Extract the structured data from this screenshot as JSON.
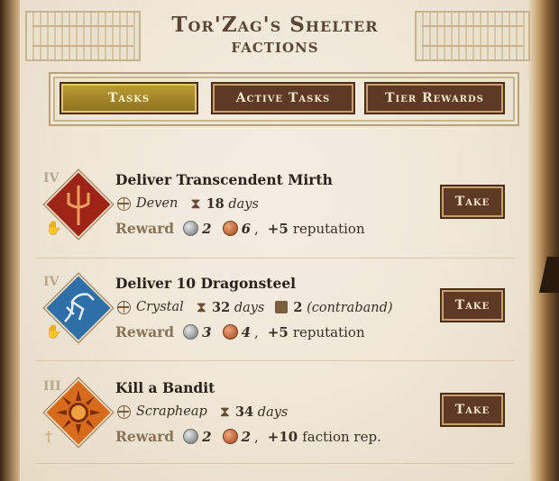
{
  "header": {
    "title": "Tor'Zag's Shelter",
    "subtitle": "FACTIONS"
  },
  "tabs": [
    {
      "label": "Tasks",
      "active": true
    },
    {
      "label": "Active Tasks",
      "active": false
    },
    {
      "label": "Tier Rewards",
      "active": false
    }
  ],
  "tasks": [
    {
      "tier": "IV",
      "title": "Deliver Transcendent Mirth",
      "location": "Deven",
      "days_value": "18",
      "days_unit": "days",
      "extra": "",
      "reward_label": "Reward",
      "silver": "2",
      "copper": "6",
      "rep_value": "+5",
      "rep_text": "reputation",
      "take_label": "Take",
      "icon": "trident-icon",
      "bg_color": "#9e2418"
    },
    {
      "tier": "IV",
      "title": "Deliver 10 Dragonsteel",
      "location": "Crystal",
      "days_value": "32",
      "days_unit": "days",
      "extra_count": "2",
      "extra": "(contraband)",
      "reward_label": "Reward",
      "silver": "3",
      "copper": "4",
      "rep_value": "+5",
      "rep_text": "reputation",
      "take_label": "Take",
      "icon": "dragon-icon",
      "bg_color": "#2f6fa8"
    },
    {
      "tier": "III",
      "title": "Kill a Bandit",
      "location": "Scrapheap",
      "days_value": "34",
      "days_unit": "days",
      "extra": "",
      "reward_label": "Reward",
      "silver": "2",
      "copper": "2",
      "rep_value": "+10",
      "rep_text": "faction rep.",
      "take_label": "Take",
      "icon": "sun-icon",
      "bg_color": "#d86a1c"
    }
  ],
  "colors": {
    "tab_active": "#b99b33",
    "button": "#5e3a24",
    "parchment": "#efe6d6"
  }
}
